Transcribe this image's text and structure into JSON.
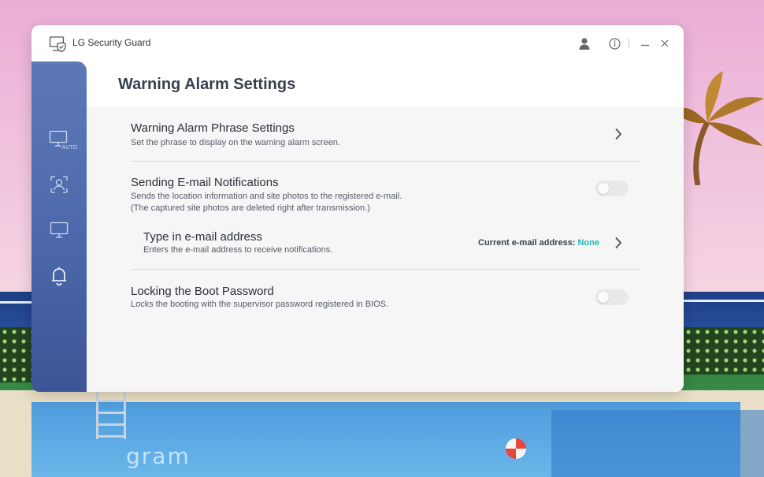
{
  "window": {
    "app_title": "LG Security Guard",
    "page_title": "Warning Alarm Settings"
  },
  "titlebar": {
    "icons": [
      "user-icon",
      "info-icon",
      "minimize-icon",
      "close-icon"
    ]
  },
  "sidebar": {
    "items": [
      {
        "icon": "monitor-auto-icon",
        "badge": "AUTO"
      },
      {
        "icon": "face-scan-icon"
      },
      {
        "icon": "monitor-icon"
      },
      {
        "icon": "bell-icon",
        "active": true
      }
    ]
  },
  "settings": {
    "phrase": {
      "title": "Warning Alarm Phrase Settings",
      "desc": "Set the phrase to display on the warning alarm screen."
    },
    "email_notifications": {
      "title": "Sending E-mail Notifications",
      "desc1": "Sends the location information and site photos to the registered e-mail.",
      "desc2": "(The captured site photos are deleted right after transmission.)",
      "enabled": false
    },
    "email_address": {
      "title": "Type in e-mail address",
      "desc": "Enters the e-mail address to receive notifications.",
      "current_label": "Current e-mail address:",
      "current_value": "None"
    },
    "boot_password": {
      "title": "Locking the Boot Password",
      "desc": "Locks the booting with the supervisor password registered in BIOS.",
      "enabled": false
    }
  },
  "wallpaper": {
    "pool_text": "gram"
  },
  "colors": {
    "accent": "#22b5b5",
    "sidebar": "#4c68ab",
    "content_bg": "#f6f6f7"
  }
}
